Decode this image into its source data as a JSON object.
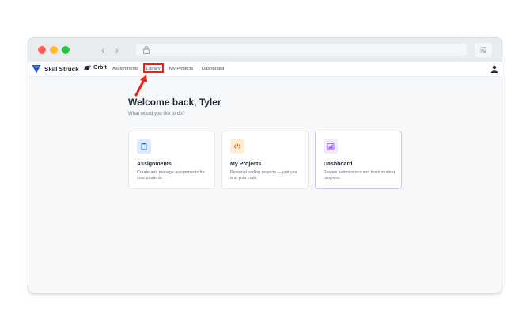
{
  "brand": {
    "name": "Skill Struck"
  },
  "orbit": {
    "name": "Orbit"
  },
  "nav": {
    "items": [
      {
        "label": "Assignments"
      },
      {
        "label": "Library"
      },
      {
        "label": "My Projects"
      },
      {
        "label": "Dashboard"
      }
    ],
    "highlighted": "Library"
  },
  "main": {
    "title": "Welcome back, Tyler",
    "subtitle": "What would you like to do?",
    "cards": [
      {
        "title": "Assignments",
        "description": "Create and manage assignments for your students",
        "icon": "clipboard-icon",
        "icon_bg": "#dbeafe",
        "icon_color": "#2563eb"
      },
      {
        "title": "My Projects",
        "description": "Personal coding projects — just you and your code",
        "icon": "code-icon",
        "icon_bg": "#ffedd5",
        "icon_color": "#ea580c"
      },
      {
        "title": "Dashboard",
        "description": "Review submissions and track student progress",
        "icon": "bar-chart-icon",
        "icon_bg": "#f3e8ff",
        "icon_color": "#9333ea"
      }
    ]
  },
  "colors": {
    "accent_brand": "#1f4fd6",
    "annotation": "#e5231b"
  }
}
